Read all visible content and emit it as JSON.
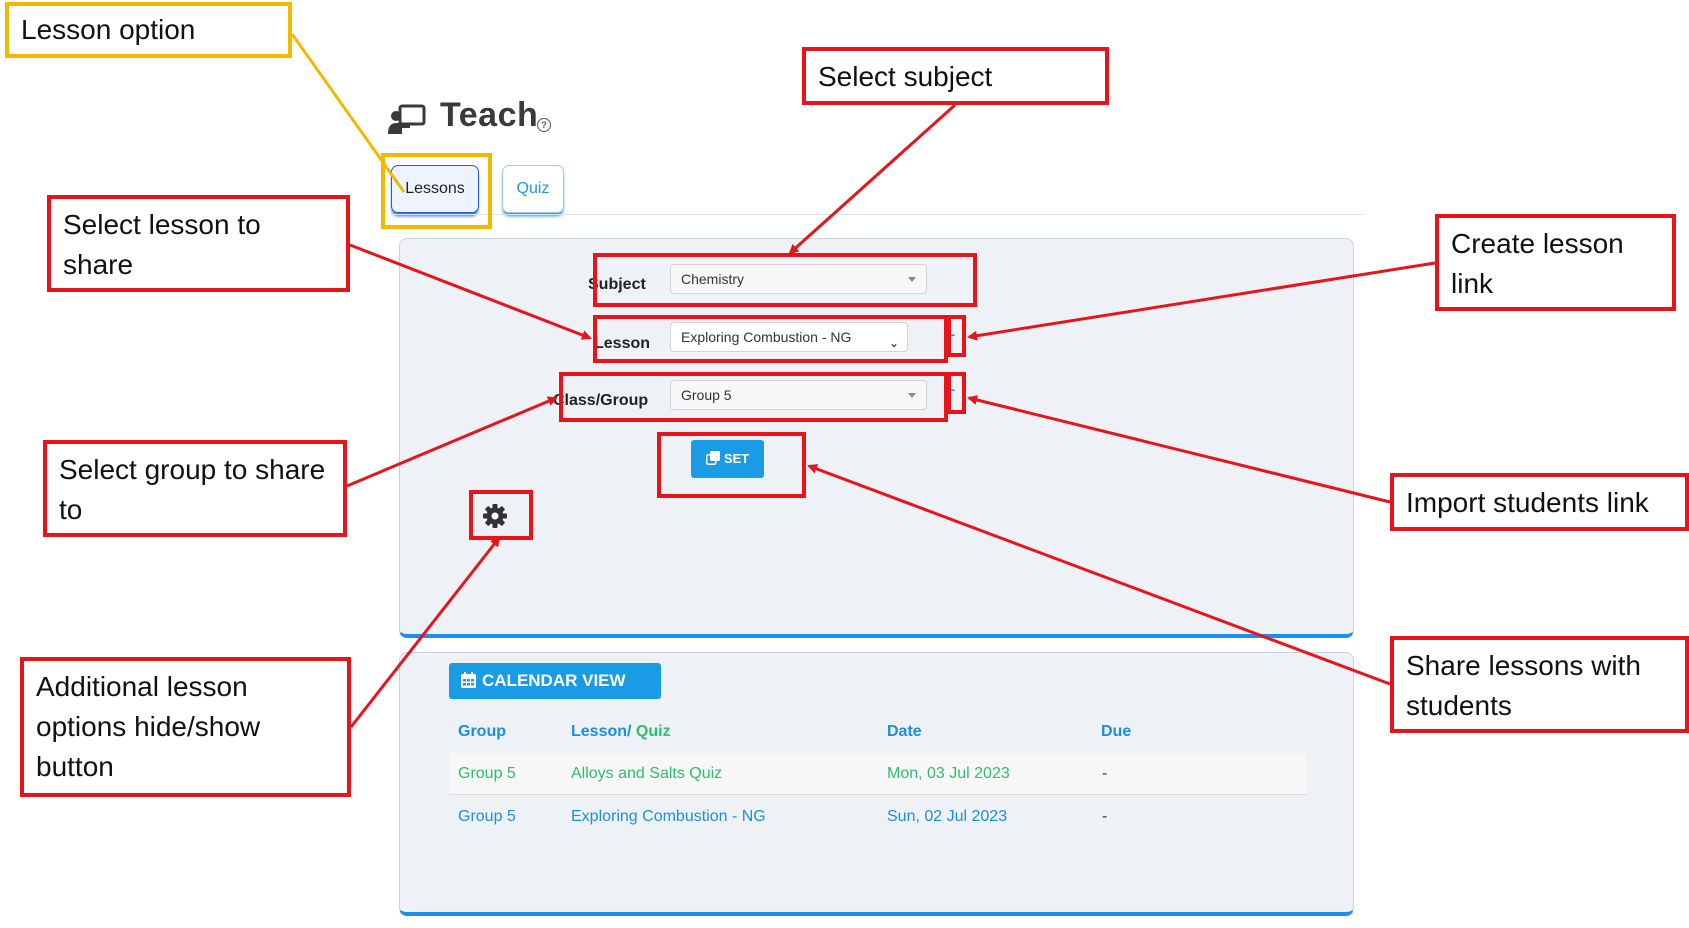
{
  "header": {
    "title": "Teach",
    "help": "?"
  },
  "tabs": [
    {
      "label": "Lessons",
      "active": true
    },
    {
      "label": "Quiz",
      "active": false
    }
  ],
  "form": {
    "subject_label": "Subject",
    "subject_value": "Chemistry",
    "lesson_label": "Lesson",
    "lesson_value": "Exploring Combustion - NG",
    "group_label": "Class/Group",
    "group_value": "Group 5",
    "plus": "+",
    "set_label": "SET"
  },
  "calendar": {
    "button_label": "CALENDAR VIEW",
    "headers": {
      "group": "Group",
      "lesson": "Lesson/",
      "quiz": "Quiz",
      "date": "Date",
      "due": "Due"
    },
    "rows": [
      {
        "group": "Group 5",
        "lesson": "Alloys and Salts Quiz",
        "date": "Mon, 03 Jul 2023",
        "due": "-",
        "type": "quiz"
      },
      {
        "group": "Group 5",
        "lesson": "Exploring Combustion - NG",
        "date": "Sun, 02 Jul 2023",
        "due": "-",
        "type": "lesson"
      }
    ]
  },
  "annotations": {
    "lesson_option": "Lesson option",
    "select_subject": "Select subject",
    "select_lesson": "Select lesson to share",
    "create_lesson_link": "Create lesson link",
    "select_group": "Select group to share to",
    "import_students": "Import students link",
    "additional_options": "Additional lesson options hide/show button",
    "share_lessons": "Share lessons with students"
  },
  "colors": {
    "accent": "#1a9be6",
    "quiz_green": "#2bbf6e",
    "annotation_red": "#e8141b",
    "annotation_yellow": "#f5b800",
    "panel_bg": "#eef1f6"
  },
  "icons": {
    "teach": "teacher-board-icon",
    "settings": "gear-icon",
    "set": "copy-icon",
    "calendar": "calendar-icon"
  }
}
